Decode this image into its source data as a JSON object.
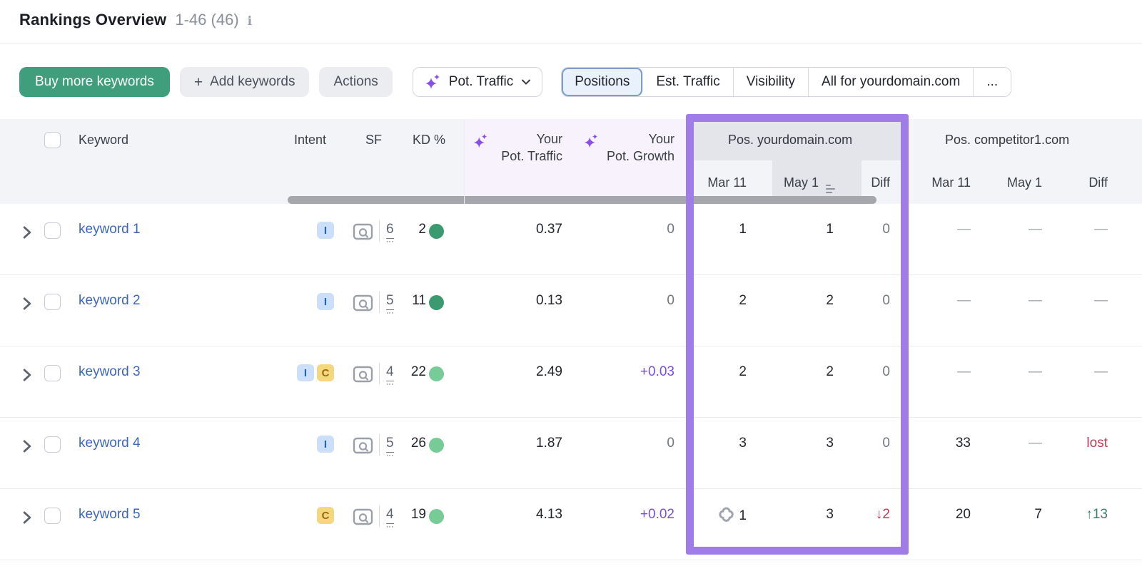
{
  "header": {
    "title": "Rankings Overview",
    "range": "1-46 (46)"
  },
  "toolbar": {
    "buy_label": "Buy more keywords",
    "add_label": "Add keywords",
    "actions_label": "Actions",
    "metric_dropdown": "Pot. Traffic",
    "tabs": [
      "Positions",
      "Est. Traffic",
      "Visibility",
      "All for yourdomain.com",
      "..."
    ],
    "active_tab": "Positions"
  },
  "table": {
    "columns": {
      "keyword": "Keyword",
      "intent": "Intent",
      "sf": "SF",
      "kd": "KD %"
    },
    "ai_columns": {
      "pot_traffic_line1": "Your",
      "pot_traffic_line2": "Pot. Traffic",
      "pot_growth_line1": "Your",
      "pot_growth_line2": "Pot. Growth"
    },
    "groups": {
      "yours": "Pos. yourdomain.com",
      "competitor": "Pos. competitor1.com"
    },
    "subcols": {
      "mar": "Mar 11",
      "may": "May 1",
      "diff": "Diff"
    },
    "sorted_column": "May 1",
    "rows": [
      {
        "keyword": "keyword 1",
        "intents": [
          "I"
        ],
        "sf": "6",
        "kd": "2",
        "kd_level": "dark",
        "pot_traffic": "0.37",
        "pot_growth": "0",
        "growth_style": "muted",
        "pos": {
          "mar": "1",
          "mar_icon": false,
          "may": "1",
          "diff": "0",
          "diff_style": "muted"
        },
        "comp": {
          "mar": "—",
          "may": "—",
          "diff": "—",
          "mar_style": "dash",
          "may_style": "dash",
          "diff_style": "dash"
        }
      },
      {
        "keyword": "keyword 2",
        "intents": [
          "I"
        ],
        "sf": "5",
        "kd": "11",
        "kd_level": "dark",
        "pot_traffic": "0.13",
        "pot_growth": "0",
        "growth_style": "muted",
        "pos": {
          "mar": "2",
          "mar_icon": false,
          "may": "2",
          "diff": "0",
          "diff_style": "muted"
        },
        "comp": {
          "mar": "—",
          "may": "—",
          "diff": "—",
          "mar_style": "dash",
          "may_style": "dash",
          "diff_style": "dash"
        }
      },
      {
        "keyword": "keyword 3",
        "intents": [
          "I",
          "C"
        ],
        "sf": "4",
        "kd": "22",
        "kd_level": "light",
        "pot_traffic": "2.49",
        "pot_growth": "+0.03",
        "growth_style": "purple",
        "pos": {
          "mar": "2",
          "mar_icon": false,
          "may": "2",
          "diff": "0",
          "diff_style": "muted"
        },
        "comp": {
          "mar": "—",
          "may": "—",
          "diff": "—",
          "mar_style": "dash",
          "may_style": "dash",
          "diff_style": "dash"
        }
      },
      {
        "keyword": "keyword 4",
        "intents": [
          "I"
        ],
        "sf": "5",
        "kd": "26",
        "kd_level": "light",
        "pot_traffic": "1.87",
        "pot_growth": "0",
        "growth_style": "muted",
        "pos": {
          "mar": "3",
          "mar_icon": false,
          "may": "3",
          "diff": "0",
          "diff_style": "muted"
        },
        "comp": {
          "mar": "33",
          "may": "—",
          "diff": "lost",
          "mar_style": "",
          "may_style": "dash",
          "diff_style": "red"
        }
      },
      {
        "keyword": "keyword 5",
        "intents": [
          "C"
        ],
        "sf": "4",
        "kd": "19",
        "kd_level": "light",
        "pot_traffic": "4.13",
        "pot_growth": "+0.02",
        "growth_style": "purple",
        "pos": {
          "mar": "1",
          "mar_icon": true,
          "may": "3",
          "diff": "↓2",
          "diff_style": "red"
        },
        "comp": {
          "mar": "20",
          "may": "7",
          "diff": "↑13",
          "mar_style": "",
          "may_style": "",
          "diff_style": "green"
        }
      }
    ]
  },
  "colors": {
    "accent_green": "#3f9e7c",
    "annotation_purple": "#a07ce8",
    "ai_purple": "#8a4fe8",
    "link_blue": "#3b66c0",
    "kd_dark_green": "#3c9a70",
    "kd_light_green": "#77cb96",
    "negative_red": "#bf3a55",
    "positive_green": "#35836b"
  }
}
